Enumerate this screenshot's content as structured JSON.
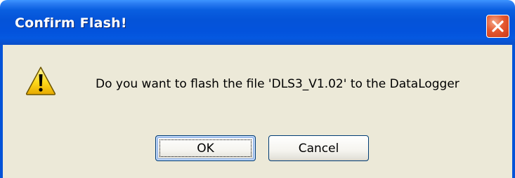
{
  "window": {
    "title": "Confirm Flash!",
    "accent_color": "#0453d8",
    "close_icon": "close-icon"
  },
  "dialog": {
    "icon": "warning-icon",
    "message": "Do you want to flash the file 'DLS3_V1.02' to the DataLogger"
  },
  "buttons": {
    "ok_label": "OK",
    "cancel_label": "Cancel",
    "default": "OK"
  }
}
